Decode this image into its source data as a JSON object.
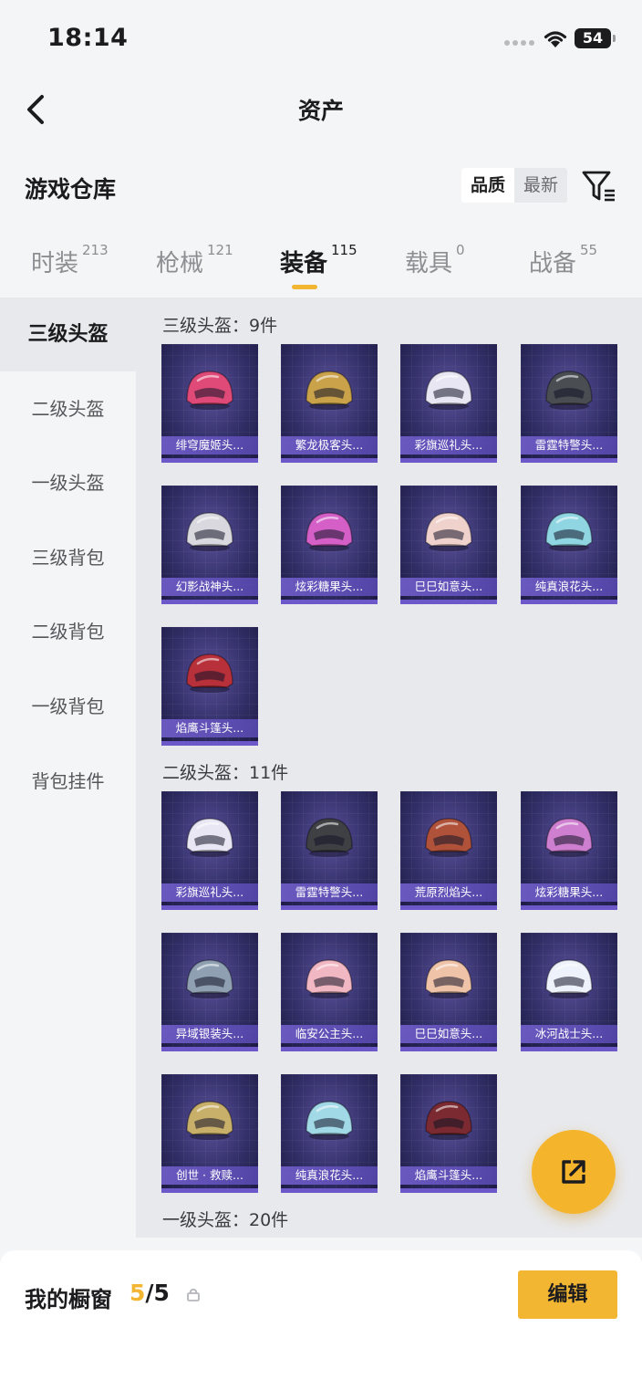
{
  "status_bar": {
    "time": "18:14",
    "battery": "54"
  },
  "nav": {
    "title": "资产"
  },
  "section": {
    "title": "游戏仓库",
    "sort_options": [
      "品质",
      "最新"
    ]
  },
  "tabs": [
    {
      "label": "时装",
      "count": "213"
    },
    {
      "label": "枪械",
      "count": "121"
    },
    {
      "label": "装备",
      "count": "115"
    },
    {
      "label": "载具",
      "count": "0"
    },
    {
      "label": "战备",
      "count": "55"
    }
  ],
  "sidebar": {
    "items": [
      "三级头盔",
      "二级头盔",
      "一级头盔",
      "三级背包",
      "二级背包",
      "一级背包",
      "背包挂件"
    ],
    "active": "三级头盔"
  },
  "groups": [
    {
      "title": "三级头盔：9件",
      "items": [
        {
          "name": "绯穹魔姬头...",
          "color": "#e04a78"
        },
        {
          "name": "繁龙极客头...",
          "color": "#c9a24a"
        },
        {
          "name": "彩旗巡礼头...",
          "color": "#e8e6f2"
        },
        {
          "name": "雷霆特警头...",
          "color": "#4a4d52"
        },
        {
          "name": "幻影战神头...",
          "color": "#d8d8de"
        },
        {
          "name": "炫彩糖果头...",
          "color": "#d35fc7"
        },
        {
          "name": "巳巳如意头...",
          "color": "#f0d2cc"
        },
        {
          "name": "纯真浪花头...",
          "color": "#8fd6e2"
        },
        {
          "name": "焰鹰斗篷头...",
          "color": "#b8303a"
        }
      ]
    },
    {
      "title": "二级头盔：11件",
      "items": [
        {
          "name": "彩旗巡礼头...",
          "color": "#e9e7f3"
        },
        {
          "name": "雷霆特警头...",
          "color": "#3e4044"
        },
        {
          "name": "荒原烈焰头...",
          "color": "#b0523a"
        },
        {
          "name": "炫彩糖果头...",
          "color": "#cf7fcf"
        },
        {
          "name": "异域银装头...",
          "color": "#8fa0b3"
        },
        {
          "name": "临安公主头...",
          "color": "#f1b7c2"
        },
        {
          "name": "巳巳如意头...",
          "color": "#efc3a8"
        },
        {
          "name": "冰河战士头...",
          "color": "#eef2fa"
        },
        {
          "name": "创世 · 救赎...",
          "color": "#c9b06a"
        },
        {
          "name": "纯真浪花头...",
          "color": "#a2d9e6"
        },
        {
          "name": "焰鹰斗篷头...",
          "color": "#7a2a30"
        }
      ]
    },
    {
      "title": "一级头盔：20件",
      "items": []
    }
  ],
  "showcase": {
    "label": "我的橱窗",
    "current": "5",
    "total": "/5",
    "edit_label": "编辑"
  },
  "colors": {
    "accent": "#f2b632",
    "card_bg": "#33306a",
    "card_label": "#6c58c8"
  }
}
